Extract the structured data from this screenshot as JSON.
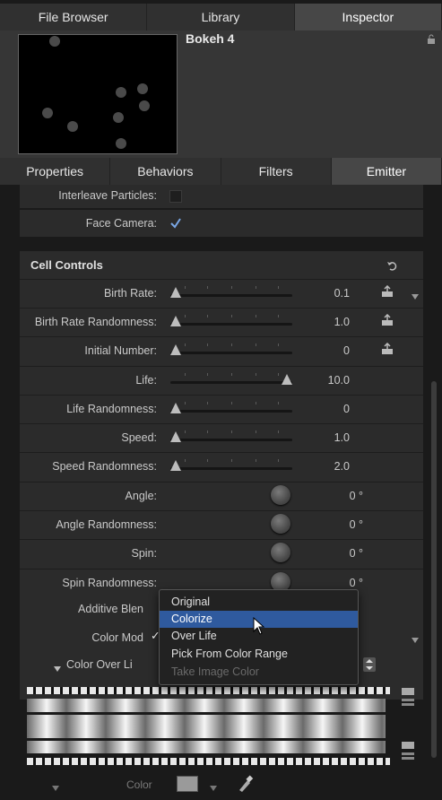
{
  "top_tabs": [
    {
      "label": "File Browser"
    },
    {
      "label": "Library"
    },
    {
      "label": "Inspector"
    }
  ],
  "preview": {
    "title": "Bokeh 4"
  },
  "sub_tabs": [
    {
      "label": "Properties"
    },
    {
      "label": "Behaviors"
    },
    {
      "label": "Filters"
    },
    {
      "label": "Emitter"
    }
  ],
  "toggles": {
    "interleave": {
      "label": "Interleave Particles:"
    },
    "face_camera": {
      "label": "Face Camera:"
    }
  },
  "cell_controls": {
    "title": "Cell Controls"
  },
  "params": [
    {
      "label": "Birth Rate:",
      "value": "0.1",
      "level": 0.0
    },
    {
      "label": "Birth Rate Randomness:",
      "value": "1.0",
      "level": 0.0
    },
    {
      "label": "Initial Number:",
      "value": "0",
      "level": 0.0
    },
    {
      "label": "Life:",
      "value": "10.0",
      "level": 1.0
    },
    {
      "label": "Life Randomness:",
      "value": "0",
      "level": 0.0
    },
    {
      "label": "Speed:",
      "value": "1.0",
      "level": 0.0
    },
    {
      "label": "Speed Randomness:",
      "value": "2.0",
      "level": 0.0
    }
  ],
  "dials": [
    {
      "label": "Angle:",
      "value": "0 °"
    },
    {
      "label": "Angle Randomness:",
      "value": "0 °"
    },
    {
      "label": "Spin:",
      "value": "0 °"
    },
    {
      "label": "Spin Randomness:",
      "value": "0 °"
    }
  ],
  "partial_labels": {
    "additive": "Additive Blen",
    "color_mode": "Color Mod",
    "color_over_life": "Color Over Li"
  },
  "menu": {
    "items": [
      {
        "label": "Original"
      },
      {
        "label": "Colorize"
      },
      {
        "label": "Over Life",
        "check": "✓"
      },
      {
        "label": "Pick From Color Range"
      },
      {
        "label": "Take Image Color"
      }
    ]
  },
  "bottom": {
    "color_label": "Color"
  }
}
